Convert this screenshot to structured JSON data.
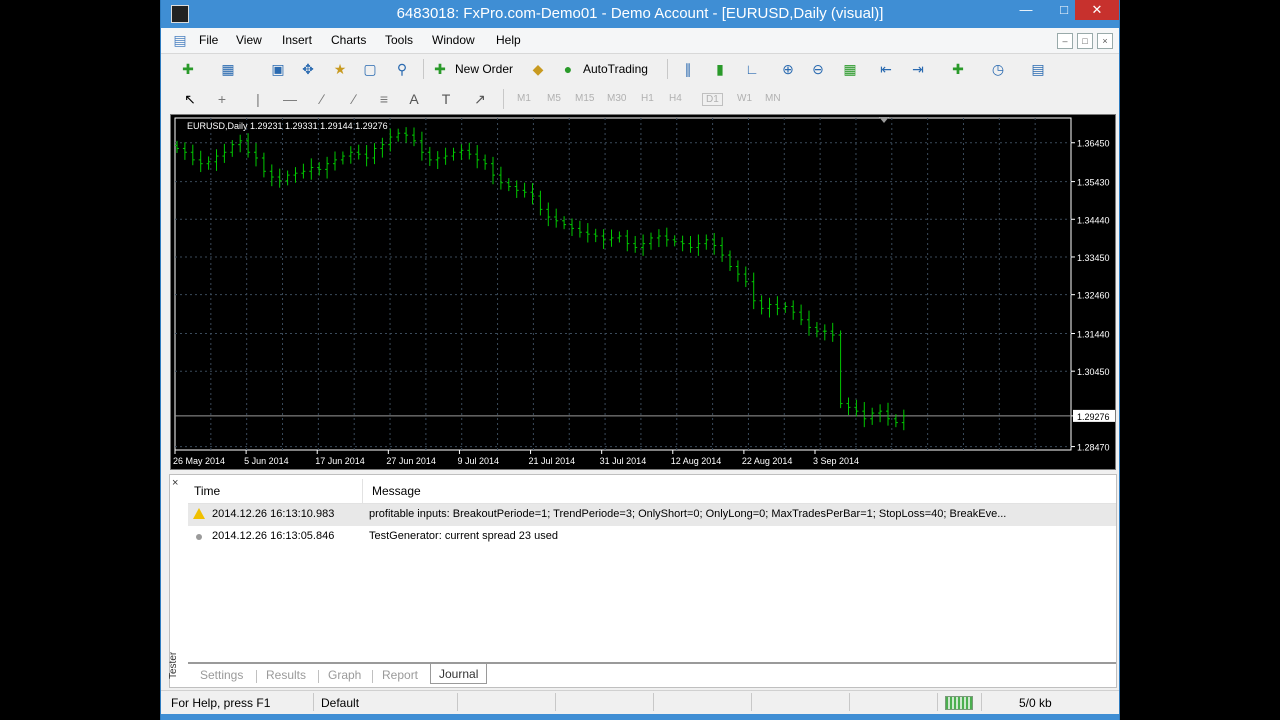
{
  "window": {
    "title": "6483018: FxPro.com-Demo01 - Demo Account - [EURUSD,Daily (visual)]",
    "min_glyph": "—",
    "max_glyph": "□",
    "close_glyph": "✕"
  },
  "menu": {
    "items": [
      "File",
      "View",
      "Insert",
      "Charts",
      "Tools",
      "Window",
      "Help"
    ],
    "mdi": [
      "–",
      "□",
      "×"
    ]
  },
  "toolbar": {
    "new_order": "New Order",
    "autotrading": "AutoTrading",
    "timeframes": [
      "M1",
      "M5",
      "M15",
      "M30",
      "H1",
      "H4",
      "D1",
      "W1",
      "MN"
    ]
  },
  "chart": {
    "info": "EURUSD,Daily  1.29231 1.29331 1.29144 1.29276",
    "price_labels": [
      "1.36450",
      "1.35430",
      "1.34440",
      "1.33450",
      "1.32460",
      "1.31440",
      "1.30450",
      "1.29276",
      "1.28470"
    ],
    "current_price": "1.29276",
    "date_labels": [
      "26 May 2014",
      "5 Jun 2014",
      "17 Jun 2014",
      "27 Jun 2014",
      "9 Jul 2014",
      "21 Jul 2014",
      "31 Jul 2014",
      "12 Aug 2014",
      "22 Aug 2014",
      "3 Sep 2014"
    ],
    "colors": {
      "background": "#000000",
      "candle": "#00c800",
      "grid": "#3a4a5a",
      "axis": "#ffffff"
    }
  },
  "chart_data": {
    "type": "bar",
    "title": "EURUSD,Daily",
    "ohlc_last": {
      "open": 1.29231,
      "high": 1.29331,
      "low": 1.29144,
      "close": 1.29276
    },
    "x_labels": [
      "26 May 2014",
      "5 Jun 2014",
      "17 Jun 2014",
      "27 Jun 2014",
      "9 Jul 2014",
      "21 Jul 2014",
      "31 Jul 2014",
      "12 Aug 2014",
      "22 Aug 2014",
      "3 Sep 2014"
    ],
    "ylim": [
      1.2838,
      1.371
    ],
    "close": [
      1.363,
      1.362,
      1.36,
      1.359,
      1.3595,
      1.361,
      1.362,
      1.364,
      1.365,
      1.362,
      1.3605,
      1.357,
      1.3555,
      1.3545,
      1.356,
      1.3565,
      1.357,
      1.358,
      1.3575,
      1.359,
      1.36,
      1.361,
      1.362,
      1.3615,
      1.3605,
      1.363,
      1.364,
      1.366,
      1.367,
      1.3665,
      1.365,
      1.362,
      1.36,
      1.3605,
      1.361,
      1.362,
      1.3625,
      1.3615,
      1.36,
      1.359,
      1.356,
      1.354,
      1.353,
      1.352,
      1.3515,
      1.3505,
      1.347,
      1.345,
      1.344,
      1.343,
      1.342,
      1.341,
      1.3405,
      1.34,
      1.339,
      1.3395,
      1.34,
      1.338,
      1.337,
      1.338,
      1.3395,
      1.34,
      1.339,
      1.3385,
      1.338,
      1.337,
      1.338,
      1.339,
      1.3375,
      1.335,
      1.332,
      1.33,
      1.328,
      1.323,
      1.321,
      1.322,
      1.321,
      1.3215,
      1.32,
      1.318,
      1.316,
      1.315,
      1.315,
      1.314,
      1.296,
      1.295,
      1.294,
      1.292,
      1.2935,
      1.294,
      1.292,
      1.291,
      1.2928
    ],
    "grid": true
  },
  "journal": {
    "headers": {
      "time": "Time",
      "message": "Message"
    },
    "rows": [
      {
        "time": "2014.12.26 16:13:10.983",
        "message": "profitable inputs: BreakoutPeriode=1; TrendPeriode=3; OnlyShort=0; OnlyLong=0; MaxTradesPerBar=1; StopLoss=40; BreakEve...",
        "level": "warning"
      },
      {
        "time": "2014.12.26 16:13:05.846",
        "message": "TestGenerator: current spread 23 used",
        "level": "info"
      }
    ],
    "close_glyph": "×",
    "side_label": "Tester",
    "tabs": [
      "Settings",
      "Results",
      "Graph",
      "Report",
      "Journal"
    ],
    "active_tab": "Journal"
  },
  "statusbar": {
    "help": "For Help, press F1",
    "profile": "Default",
    "traffic": "5/0 kb"
  }
}
